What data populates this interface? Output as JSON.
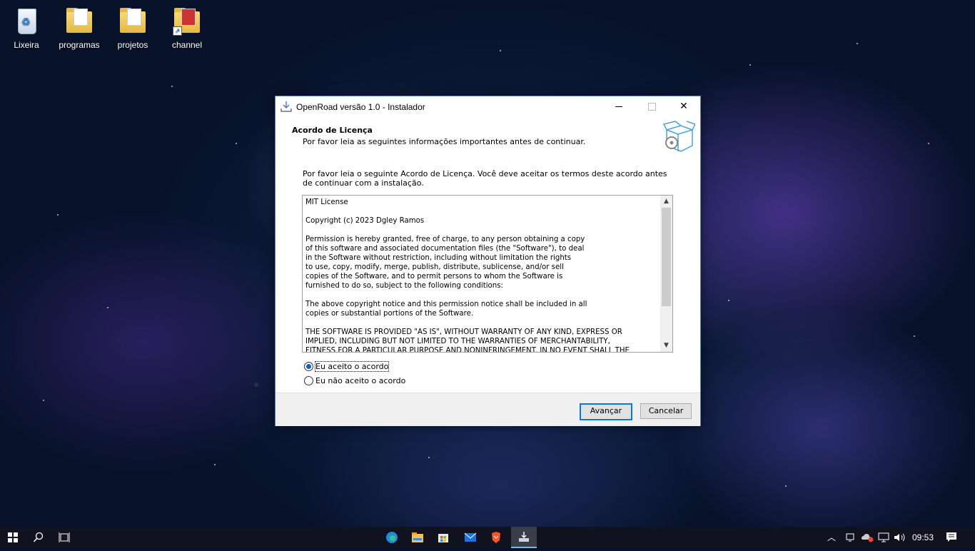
{
  "desktop": {
    "icons": [
      {
        "label": "Lixeira"
      },
      {
        "label": "programas"
      },
      {
        "label": "projetos"
      },
      {
        "label": "channel"
      }
    ]
  },
  "window": {
    "title": "OpenRoad versão 1.0 - Instalador",
    "header_title": "Acordo de Licença",
    "header_subtitle": "Por favor leia as seguintes informações importantes antes de continuar.",
    "intro": "Por favor leia o seguinte Acordo de Licença. Você deve aceitar os termos deste acordo antes de continuar com a instalação.",
    "license_text": "MIT License\n\nCopyright (c) 2023 Dgley Ramos\n\nPermission is hereby granted, free of charge, to any person obtaining a copy\nof this software and associated documentation files (the \"Software\"), to deal\nin the Software without restriction, including without limitation the rights\nto use, copy, modify, merge, publish, distribute, sublicense, and/or sell\ncopies of the Software, and to permit persons to whom the Software is\nfurnished to do so, subject to the following conditions:\n\nThe above copyright notice and this permission notice shall be included in all\ncopies or substantial portions of the Software.\n\nTHE SOFTWARE IS PROVIDED \"AS IS\", WITHOUT WARRANTY OF ANY KIND, EXPRESS OR\nIMPLIED, INCLUDING BUT NOT LIMITED TO THE WARRANTIES OF MERCHANTABILITY,\nFITNESS FOR A PARTICULAR PURPOSE AND NONINFRINGEMENT. IN NO EVENT SHALL THE",
    "radio_accept": "Eu aceito o acordo",
    "radio_decline": "Eu não aceito o acordo",
    "selected": "accept",
    "next_button": "Avançar",
    "cancel_button": "Cancelar"
  },
  "taskbar": {
    "clock": "09:53",
    "icons": [
      "windows-start-icon",
      "search-icon",
      "task-view-icon",
      "edge-icon",
      "file-explorer-icon",
      "store-icon",
      "mail-icon",
      "brave-icon",
      "installer-icon"
    ]
  },
  "colors": {
    "accent": "#0a78d7",
    "window_border": "#5b7fb5",
    "taskbar": "#10131f"
  }
}
